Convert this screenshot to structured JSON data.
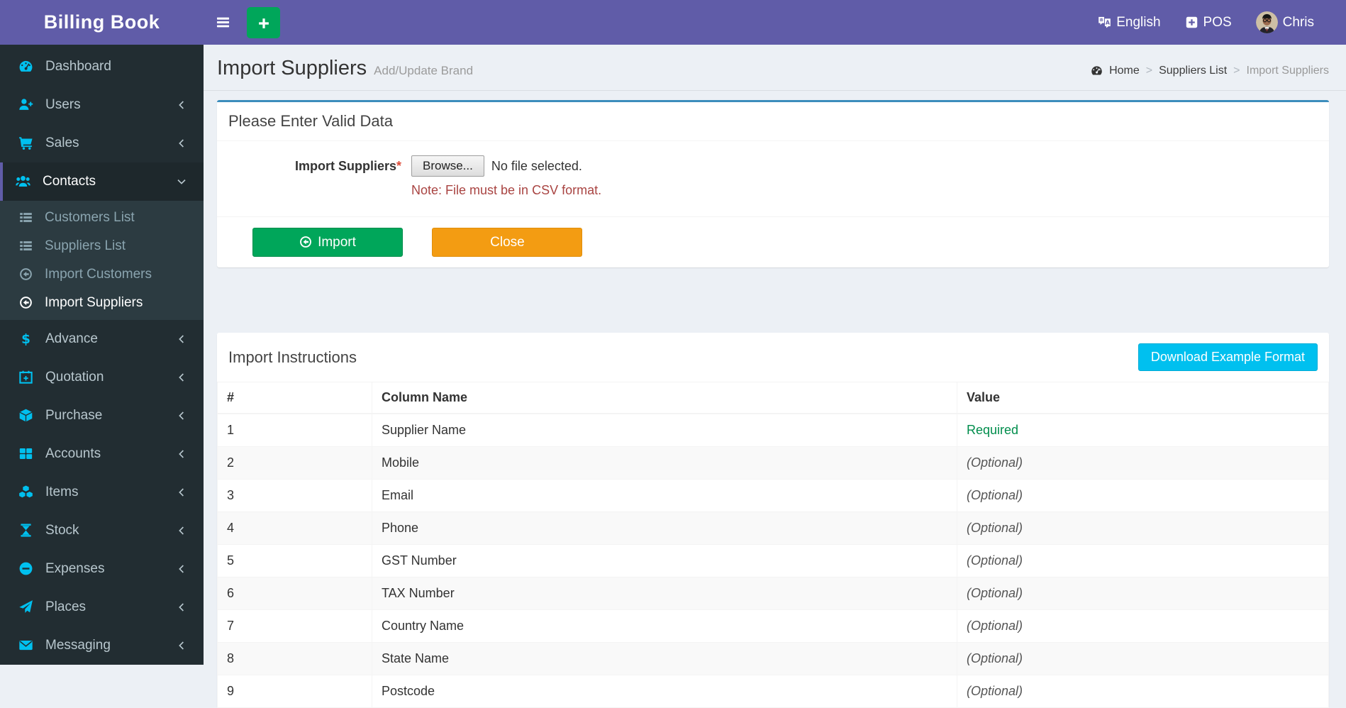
{
  "app": {
    "title": "Billing Book"
  },
  "header": {
    "language": "English",
    "pos_label": "POS",
    "user_name": "Chris"
  },
  "sidebar": {
    "items": [
      {
        "label": "Dashboard",
        "icon": "tachometer",
        "chevron": false
      },
      {
        "label": "Users",
        "icon": "user-plus",
        "chevron": true
      },
      {
        "label": "Sales",
        "icon": "cart",
        "chevron": true
      },
      {
        "label": "Contacts",
        "icon": "users",
        "chevron": true,
        "active": true,
        "expanded": true,
        "children": [
          {
            "label": "Customers List",
            "icon": "list"
          },
          {
            "label": "Suppliers List",
            "icon": "list"
          },
          {
            "label": "Import Customers",
            "icon": "arrow-circle-left"
          },
          {
            "label": "Import Suppliers",
            "icon": "arrow-circle-left",
            "active": true
          }
        ]
      },
      {
        "label": "Advance",
        "icon": "dollar",
        "chevron": true
      },
      {
        "label": "Quotation",
        "icon": "calendar-plus",
        "chevron": true
      },
      {
        "label": "Purchase",
        "icon": "cube",
        "chevron": true
      },
      {
        "label": "Accounts",
        "icon": "th-large",
        "chevron": true
      },
      {
        "label": "Items",
        "icon": "cubes",
        "chevron": true
      },
      {
        "label": "Stock",
        "icon": "hourglass",
        "chevron": true
      },
      {
        "label": "Expenses",
        "icon": "minus-circle",
        "chevron": true
      },
      {
        "label": "Places",
        "icon": "paper-plane",
        "chevron": true
      },
      {
        "label": "Messaging",
        "icon": "envelope",
        "chevron": true
      }
    ]
  },
  "page": {
    "title": "Import Suppliers",
    "subtitle": "Add/Update Brand",
    "breadcrumb": [
      {
        "label": "Home",
        "current": false
      },
      {
        "label": "Suppliers List",
        "current": false
      },
      {
        "label": "Import Suppliers",
        "current": true
      }
    ]
  },
  "form_card": {
    "title": "Please Enter Valid Data",
    "field_label": "Import Suppliers",
    "required_mark": "*",
    "browse_label": "Browse...",
    "file_status": "No file selected.",
    "note": "Note: File must be in CSV format.",
    "import_label": "Import",
    "close_label": "Close"
  },
  "instructions_card": {
    "title": "Import Instructions",
    "download_label": "Download Example Format",
    "table": {
      "headers": [
        "#",
        "Column Name",
        "Value"
      ],
      "rows": [
        {
          "num": "1",
          "column": "Supplier Name",
          "value": "Required",
          "required": true
        },
        {
          "num": "2",
          "column": "Mobile",
          "value": "(Optional)",
          "required": false
        },
        {
          "num": "3",
          "column": "Email",
          "value": "(Optional)",
          "required": false
        },
        {
          "num": "4",
          "column": "Phone",
          "value": "(Optional)",
          "required": false
        },
        {
          "num": "5",
          "column": "GST Number",
          "value": "(Optional)",
          "required": false
        },
        {
          "num": "6",
          "column": "TAX Number",
          "value": "(Optional)",
          "required": false
        },
        {
          "num": "7",
          "column": "Country Name",
          "value": "(Optional)",
          "required": false
        },
        {
          "num": "8",
          "column": "State Name",
          "value": "(Optional)",
          "required": false
        },
        {
          "num": "9",
          "column": "Postcode",
          "value": "(Optional)",
          "required": false
        }
      ]
    }
  },
  "colors": {
    "header_purple": "#605ca8",
    "sidebar_dark": "#222d32",
    "sidebar_active": "#1e282c",
    "submenu_bg": "#2c3b41",
    "icon_cyan": "#00c0ef",
    "success_green": "#00a65a",
    "warning_orange": "#f39c12",
    "info_cyan": "#00c0ef",
    "required_green": "#008d4c",
    "note_red": "#a94442",
    "card_top_blue": "#3c8dbc",
    "page_bg": "#ecf0f5"
  }
}
